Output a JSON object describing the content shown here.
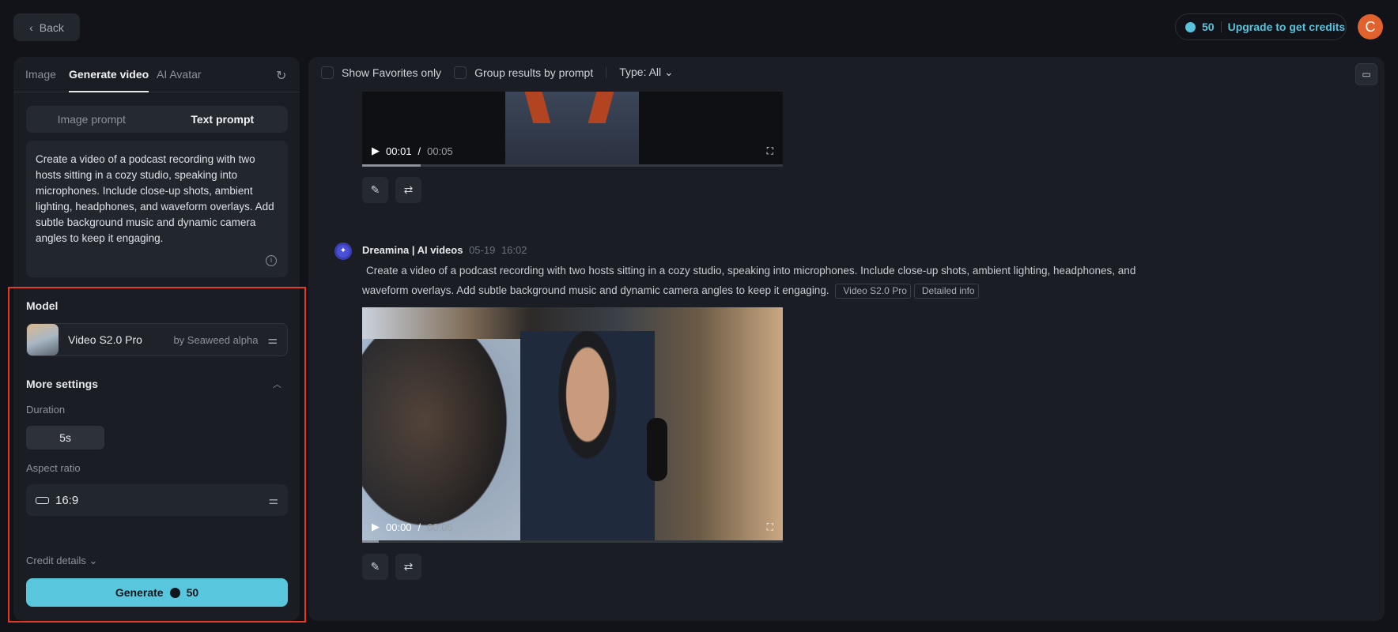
{
  "header": {
    "back_label": "Back",
    "credits": "50",
    "upgrade_label": "Upgrade to get credits",
    "user_initial": "C"
  },
  "left": {
    "tabs": [
      {
        "label": "Image"
      },
      {
        "label": "Generate video"
      },
      {
        "label": "AI Avatar"
      }
    ],
    "prompt_modes": [
      {
        "label": "Image prompt"
      },
      {
        "label": "Text prompt"
      }
    ],
    "prompt_text": "Create a video of a podcast recording with two hosts sitting in a cozy studio, speaking into microphones. Include close-up shots, ambient lighting, headphones, and waveform overlays. Add subtle background music and dynamic camera angles to keep it engaging.",
    "model_label": "Model",
    "model_name": "Video S2.0 Pro",
    "model_by": "by Seaweed alpha",
    "more_settings": "More settings",
    "duration_label": "Duration",
    "duration_value": "5s",
    "aspect_label": "Aspect ratio",
    "aspect_value": "16:9",
    "credit_details": "Credit details",
    "generate_label": "Generate",
    "generate_cost": "50"
  },
  "main": {
    "toolbar": {
      "favorites": "Show Favorites only",
      "group": "Group results by prompt",
      "type": "Type: All"
    },
    "video1": {
      "current": "00:01",
      "sep": "/",
      "duration": "00:05",
      "progress": 0.14
    },
    "item": {
      "author": "Dreamina | AI videos",
      "date": "05-19",
      "time": "16:02",
      "prompt": "Create a video of a podcast recording with two hosts sitting in a cozy studio, speaking into microphones. Include close-up shots, ambient lighting, headphones, and waveform overlays. Add subtle background music and dynamic camera angles to keep it engaging.",
      "model_tag": "Video S2.0 Pro",
      "info_tag": "Detailed info"
    },
    "video2": {
      "current": "00:00",
      "sep": "/",
      "duration": "00:05",
      "progress": 0.04
    }
  },
  "colors": {
    "accent": "#58c6dc",
    "highlight": "#e23a26",
    "avatar": "#e2622e"
  }
}
